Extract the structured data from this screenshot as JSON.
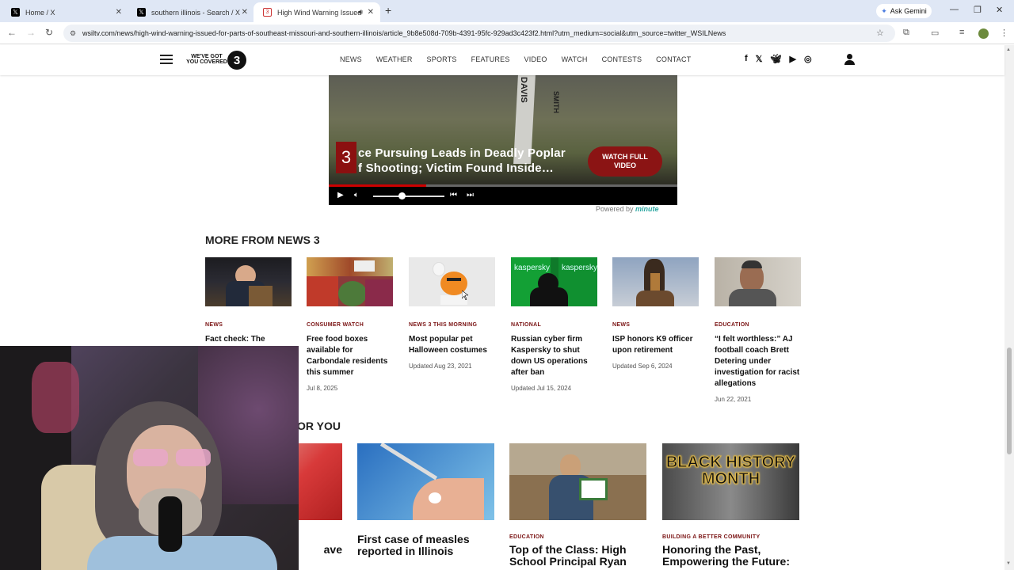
{
  "browser": {
    "tabs": [
      {
        "title": "Home / X",
        "icon": "x-logo-icon",
        "fav": "𝕏"
      },
      {
        "title": "southern illinois - Search / X",
        "icon": "x-logo-icon",
        "fav": "𝕏"
      },
      {
        "title": "High Wind Warning Issued",
        "icon": "wsil-logo-icon",
        "fav": "3"
      }
    ],
    "new_tab": "+",
    "ask_gemini": "Ask Gemini",
    "url": "wsiltv.com/news/high-wind-warning-issued-for-parts-of-southeast-missouri-and-southern-illinois/article_9b8e508d-709b-4391-95fc-929ad3c423f2.html?utm_medium=social&utm_source=twitter_WSILNews"
  },
  "site": {
    "logo_text": "WE'VE GOT YOU COVERED",
    "logo_number": "3",
    "nav": [
      "NEWS",
      "WEATHER",
      "SPORTS",
      "FEATURES",
      "VIDEO",
      "WATCH",
      "CONTESTS",
      "CONTACT"
    ],
    "social_icons": [
      "facebook-icon",
      "x-icon",
      "bluesky-icon",
      "youtube-icon",
      "instagram-icon"
    ]
  },
  "video": {
    "channel_number": "3",
    "headline_line1": "ce Pursuing Leads in Deadly Poplar",
    "headline_line2": "f Shooting; Victim Found Inside…",
    "post_text_1": "DAVIS",
    "post_text_2": "SMITH",
    "watch_full": "WATCH FULL VIDEO",
    "progress": 0.28,
    "volume": 0.4,
    "powered_by": "Powered by",
    "powered_brand": "minute"
  },
  "more_from": {
    "title": "MORE FROM NEWS 3",
    "cards": [
      {
        "category": "NEWS",
        "title": "Fact check: The second",
        "date": ""
      },
      {
        "category": "CONSUMER WATCH",
        "title": "Free food boxes available for Carbondale residents this summer",
        "date": "Jul 8, 2025"
      },
      {
        "category": "NEWS 3 THIS MORNING",
        "title": "Most popular pet Halloween costumes",
        "date": "Updated Aug 23, 2021"
      },
      {
        "category": "NATIONAL",
        "title": "Russian cyber firm Kaspersky to shut down US operations after ban",
        "date": "Updated Jul 15, 2024"
      },
      {
        "category": "NEWS",
        "title": "ISP honors K9 officer upon retirement",
        "date": "Updated Sep 6, 2024"
      },
      {
        "category": "EDUCATION",
        "title": "“I felt worthless:” AJ football coach Brett Detering under investigation for racist allegations",
        "date": "Jun 22, 2021"
      }
    ],
    "kaspersky_text": "kaspersky"
  },
  "for_you": {
    "title": "OR YOU",
    "partial_title": "ave",
    "cards": [
      {
        "category": "",
        "title": "First case of measles reported in Illinois"
      },
      {
        "category": "EDUCATION",
        "title": "Top of the Class: High School Principal Ryan"
      },
      {
        "category": "BUILDING A BETTER COMMUNITY",
        "title": "Honoring the Past, Empowering the Future:"
      }
    ],
    "bhm_text": "BLACK HISTORY MONTH"
  }
}
